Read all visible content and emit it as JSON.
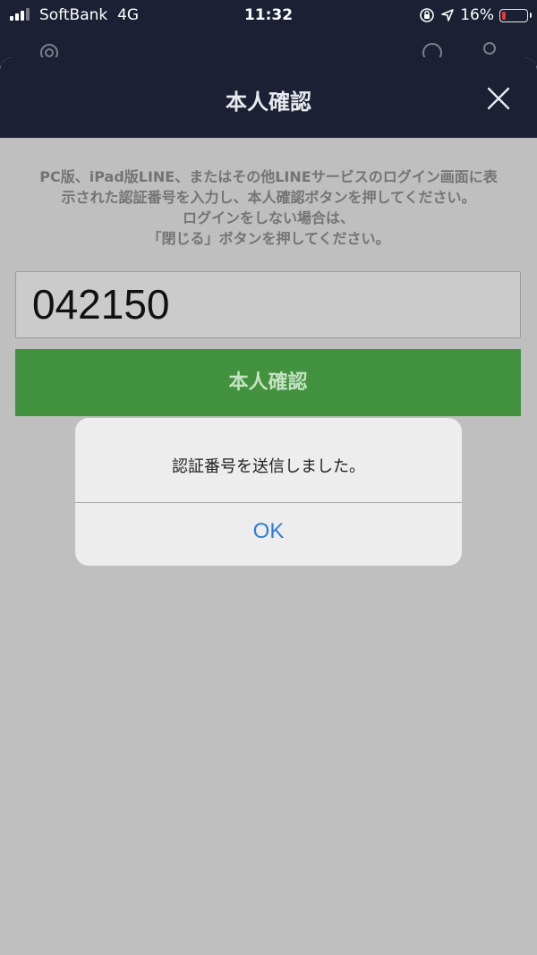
{
  "status_bar": {
    "carrier": "SoftBank",
    "network": "4G",
    "time": "11:32",
    "battery": "16%",
    "battery_level": 0.16,
    "icons": [
      "signal-bars-icon",
      "orientation-lock-icon",
      "location-arrow-icon",
      "battery-icon"
    ]
  },
  "background_app": {
    "icons": [
      "gear-icon",
      "clock-icon",
      "person-icon"
    ]
  },
  "sheet": {
    "title": "本人確認",
    "close_icon": "close-icon",
    "instructions": [
      "PC版、iPad版LINE、またはその他LINEサービスのログイン画面に表",
      "示された認証番号を入力し、本人確認ボタンを押してください。",
      "ログインをしない場合は、",
      "「閉じる」ボタンを押してください。"
    ],
    "code_value": "042150",
    "verify_button": "本人確認"
  },
  "alert": {
    "message": "認証番号を送信しました。",
    "ok_button": "OK"
  },
  "colors": {
    "header_bg": "#1b2034",
    "overlay_bg": "#bfbfbf",
    "verify_green": "#43923f",
    "alert_bg": "#ededed",
    "link_blue": "#2f7bd9",
    "battery_red": "#ff3b30"
  }
}
